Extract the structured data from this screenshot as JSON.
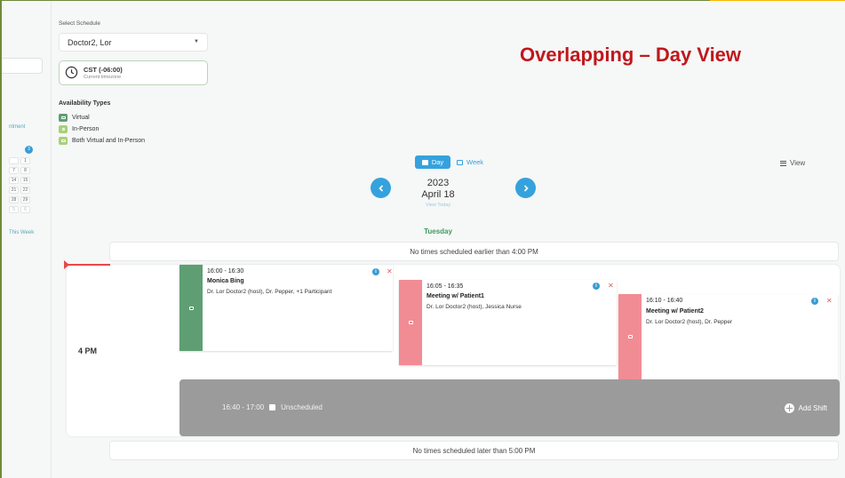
{
  "sidebar": {
    "appointment_fragment": "ntment",
    "today_badge": "3",
    "calendar_rows": [
      [
        "",
        "1"
      ],
      [
        "7",
        "8"
      ],
      [
        "14",
        "15"
      ],
      [
        "21",
        "22"
      ],
      [
        "28",
        "29"
      ],
      [
        "5",
        "6"
      ]
    ],
    "this_week": "This Week"
  },
  "schedule": {
    "label": "Select Schedule",
    "selected": "Doctor2, Lor"
  },
  "timezone": {
    "name": "CST (-06:00)",
    "caption": "Current timezone"
  },
  "availability": {
    "title": "Availability Types",
    "items": [
      {
        "label": "Virtual",
        "color": "#5f9e72"
      },
      {
        "label": "In-Person",
        "color": "#a8d07a"
      },
      {
        "label": "Both Virtual and In-Person",
        "color": "#a8d07a"
      }
    ]
  },
  "heading": "Overlapping – Day View",
  "view_toggle": {
    "day": "Day",
    "week": "Week",
    "view": "View"
  },
  "date": {
    "year": "2023",
    "month_day": "April 18",
    "view_today": "View Today",
    "weekday": "Tuesday"
  },
  "notes": {
    "earlier": "No times scheduled earlier than 4:00 PM",
    "later": "No times scheduled later than 5:00 PM"
  },
  "hour_label": "4 PM",
  "events": [
    {
      "time": "16:00 - 16:30",
      "title": "Monica Bing",
      "participants": "Dr. Lor Doctor2 (host), Dr. Pepper, +1 Participant",
      "color": "#5f9e72"
    },
    {
      "time": "16:05 - 16:35",
      "title": "Meeting w/ Patient1",
      "participants": "Dr. Lor Doctor2 (host), Jessica Nurse",
      "color": "#f28c94"
    },
    {
      "time": "16:10 - 16:40",
      "title": "Meeting w/ Patient2",
      "participants": "Dr. Lor Doctor2 (host), Dr. Pepper",
      "color": "#f28c94"
    }
  ],
  "unscheduled": {
    "time": "16:40 - 17:00",
    "label": "Unscheduled",
    "add": "Add Shift"
  },
  "colors": {
    "accent": "#35a2dd",
    "heading": "#c0171c",
    "now_line": "#e8474b"
  }
}
